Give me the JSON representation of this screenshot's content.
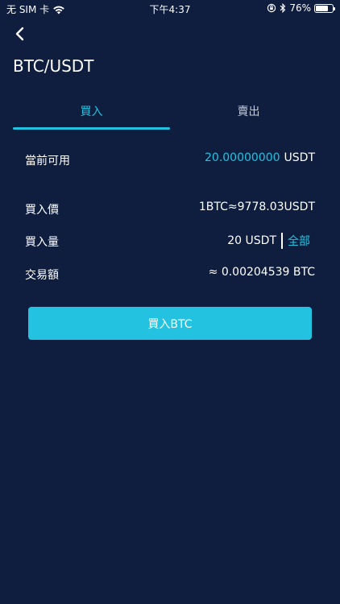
{
  "status_bar": {
    "carrier": "无 SIM 卡",
    "time": "下午4:37",
    "battery": "76%",
    "battery_level": 0.76
  },
  "nav": {
    "back_icon": "chevron-left-icon",
    "title": "BTC/USDT"
  },
  "tabs": [
    {
      "label": "買入",
      "active": true
    },
    {
      "label": "賣出",
      "active": false
    }
  ],
  "form": {
    "available": {
      "label": "當前可用",
      "amount": "20.00000000",
      "unit": "USDT"
    },
    "price": {
      "label": "買入價",
      "value": "1BTC≈9778.03USDT"
    },
    "quantity": {
      "label": "買入量",
      "value": "20 USDT",
      "all_label": "全部"
    },
    "total": {
      "label": "交易額",
      "value": "≈ 0.00204539 BTC"
    }
  },
  "submit": {
    "label": "買入BTC"
  },
  "colors": {
    "background": "#0f1d3f",
    "accent": "#22c2e0",
    "text": "#ffffff"
  }
}
